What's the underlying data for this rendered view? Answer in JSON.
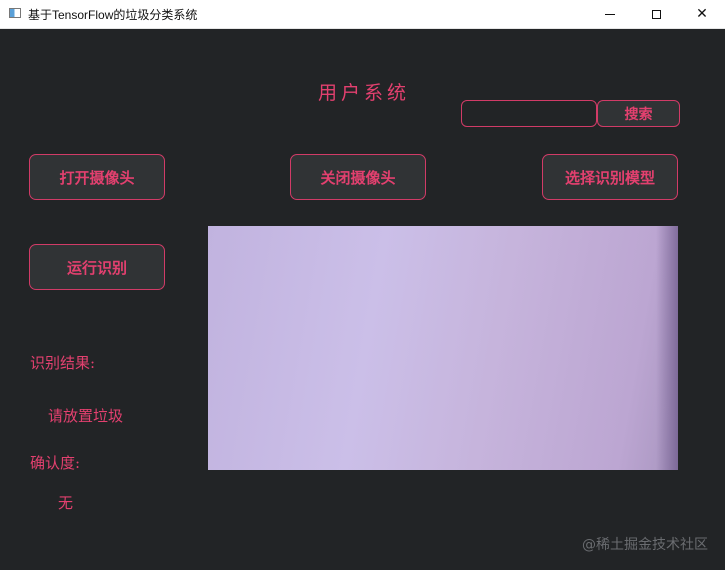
{
  "window": {
    "title": "基于TensorFlow的垃圾分类系统",
    "min_symbol": "",
    "max_symbol": "",
    "close_symbol": "✕"
  },
  "app": {
    "title": "用户系统",
    "search": {
      "value": "",
      "placeholder": "",
      "button_label": "搜索"
    },
    "buttons": {
      "open_camera": "打开摄像头",
      "close_camera": "关闭摄像头",
      "select_model": "选择识别模型",
      "run_recognition": "运行识别"
    },
    "result": {
      "label": "识别结果:",
      "value": "请放置垃圾"
    },
    "confidence": {
      "label": "确认度:",
      "value": "无"
    },
    "watermark": "@稀土掘金技术社区"
  },
  "colors": {
    "background": "#222426",
    "accent": "#e3406f",
    "button_bg": "#303335"
  },
  "icons": {
    "app": "window-app-icon",
    "minimize": "minimize-icon",
    "maximize": "maximize-icon",
    "close": "close-icon"
  }
}
